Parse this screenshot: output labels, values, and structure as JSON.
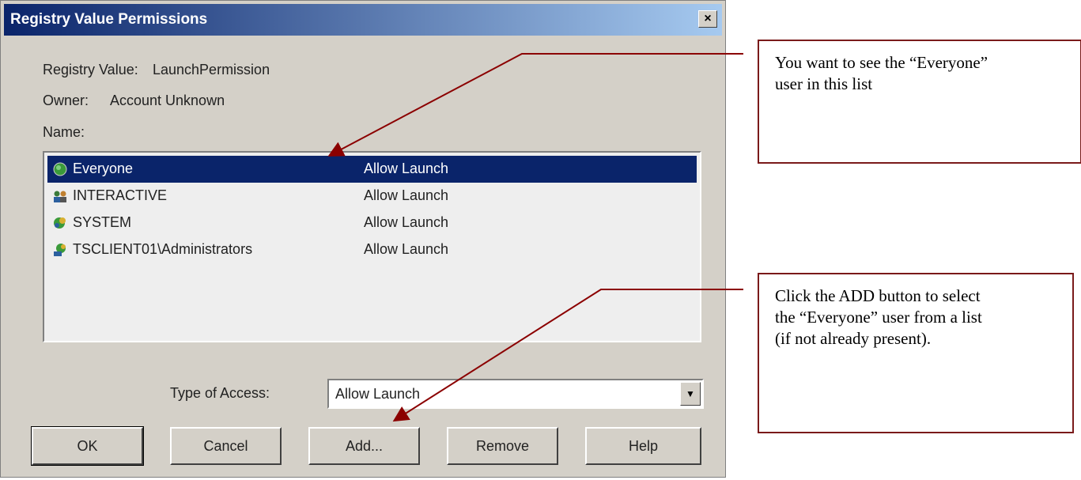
{
  "dialog": {
    "title": "Registry Value Permissions",
    "close_label": "×",
    "registry_value_label": "Registry Value:",
    "registry_value": "LaunchPermission",
    "owner_label": "Owner:",
    "owner_value": "Account Unknown",
    "name_label": "Name:",
    "list": [
      {
        "name": "Everyone",
        "access": "Allow Launch",
        "icon": "globe-icon",
        "selected": true
      },
      {
        "name": "INTERACTIVE",
        "access": "Allow Launch",
        "icon": "users-icon",
        "selected": false
      },
      {
        "name": "SYSTEM",
        "access": "Allow Launch",
        "icon": "system-icon",
        "selected": false
      },
      {
        "name": "TSCLIENT01\\Administrators",
        "access": "Allow Launch",
        "icon": "admin-group-icon",
        "selected": false
      }
    ],
    "type_of_access_label": "Type of Access:",
    "type_of_access_value": "Allow Launch",
    "buttons": {
      "ok": "OK",
      "cancel": "Cancel",
      "add": "Add...",
      "remove": "Remove",
      "help": "Help"
    }
  },
  "callouts": {
    "top": [
      "You want to see the “Everyone”",
      "user in this list"
    ],
    "bottom": [
      "Click the ADD button to select",
      "the “Everyone” user from a list",
      "(if not already present)."
    ]
  },
  "colors": {
    "selection": "#0a246a",
    "callout_border": "#7a1a1a",
    "arrow": "#8b0000"
  }
}
